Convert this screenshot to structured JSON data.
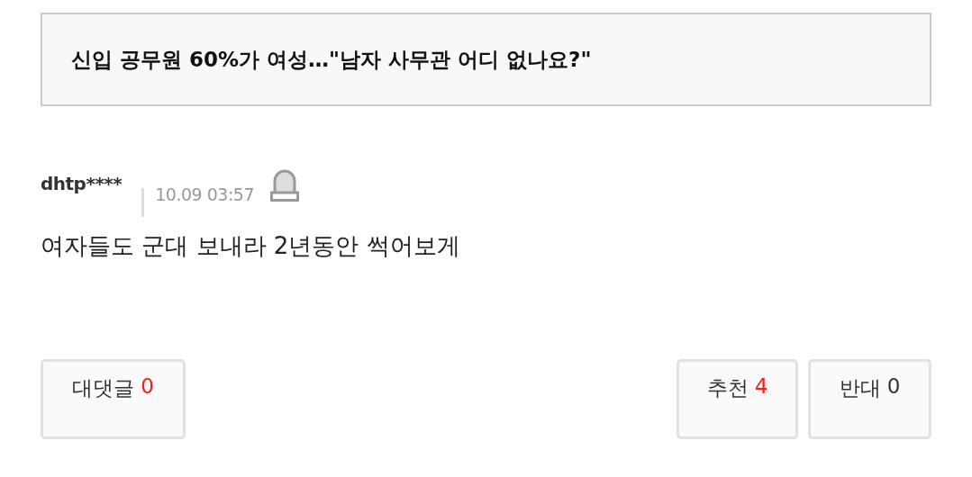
{
  "article_title": "신입 공무원 60%가 여성…\"남자 사무관 어디 없나요?\"",
  "comment": {
    "author": "dhtp****",
    "time": "10.09 03:57",
    "text": "여자들도 군대 보내라 2년동안 썩어보게"
  },
  "buttons": [
    {
      "label": "대댓글",
      "count": "0",
      "color": "#ff1a1a"
    },
    {
      "label": "추천",
      "count": "4",
      "color": "#ff1a1a"
    },
    {
      "label": "반대",
      "count": "0",
      "color": "#333333"
    }
  ]
}
